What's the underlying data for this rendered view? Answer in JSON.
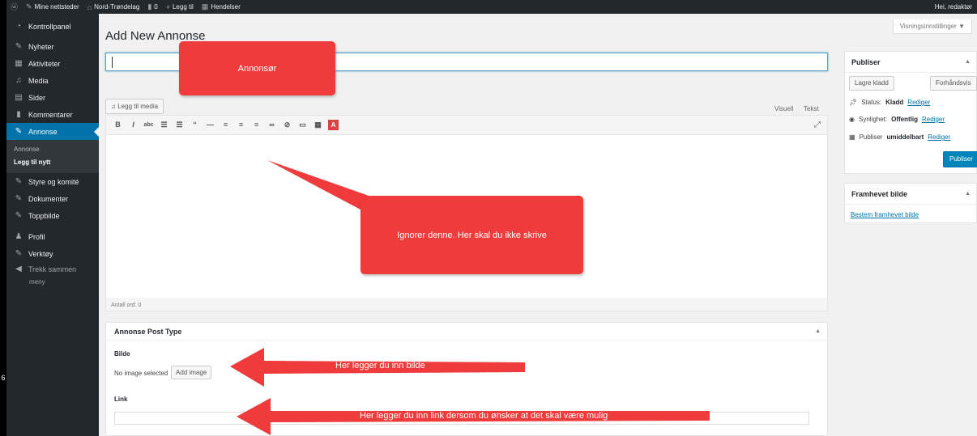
{
  "admin_bar": {
    "sites": "Mine nettsteder",
    "site_name": "Nord-Trøndelag",
    "comments_count": "0",
    "new": "Legg til",
    "events": "Hendelser",
    "greeting": "Hei, redaktør"
  },
  "sidebar": {
    "items": [
      {
        "label": "Kontrollpanel",
        "icon": "dashboard-icon"
      },
      {
        "label": "Nyheter",
        "icon": "pin-icon"
      },
      {
        "label": "Aktiviteter",
        "icon": "calendar-icon"
      },
      {
        "label": "Media",
        "icon": "media-icon"
      },
      {
        "label": "Sider",
        "icon": "page-icon"
      },
      {
        "label": "Kommentarer",
        "icon": "comment-icon"
      },
      {
        "label": "Annonse",
        "icon": "pin-icon"
      }
    ],
    "sub": {
      "annonse": "Annonse",
      "new": "Legg til nytt"
    },
    "items2": [
      {
        "label": "Styre og komité",
        "icon": "pin-icon"
      },
      {
        "label": "Dokumenter",
        "icon": "pin-icon"
      },
      {
        "label": "Toppbilde",
        "icon": "pin-icon"
      },
      {
        "label": "Profil",
        "icon": "user-icon"
      },
      {
        "label": "Verktøy",
        "icon": "wrench-icon"
      },
      {
        "label": "Trekk sammen",
        "icon": "collapse-icon"
      }
    ],
    "collapse_sub": "meny"
  },
  "main": {
    "page_title": "Add New Annonse",
    "screen_options": "Visningsinnstillinger ▼",
    "add_media": "Legg til media",
    "tab_visual": "Visuell",
    "tab_text": "Tekst",
    "word_count": "Antall ord: 0"
  },
  "postbox": {
    "title": "Annonse Post Type",
    "image_label": "Bilde",
    "no_image": "No image selected",
    "add_image": "Add image",
    "link_label": "Link"
  },
  "publish": {
    "title": "Publiser",
    "save_draft": "Lagre kladd",
    "preview": "Forhåndsvis",
    "status_label": "Status:",
    "status_value": "Kladd",
    "visibility_label": "Synlighet:",
    "visibility_value": "Offentlig",
    "publish_label": "Publiser",
    "publish_value": "umiddelbart",
    "edit": "Rediger",
    "publish_button": "Publiser"
  },
  "featured": {
    "title": "Framhevet bilde",
    "set_link": "Bestem framhevet bilde"
  },
  "annotations": {
    "title_note": "Annonsør",
    "editor_note": "Ignorer denne. Her skal du ikke skrive",
    "image_note": "Her legger du inn bilde",
    "link_note": "Her legger du inn link dersom du ønsker at det skal være mulig"
  },
  "colors": {
    "accent": "#0073aa",
    "annotation": "#ef3b3b",
    "sidebar": "#23282d"
  }
}
